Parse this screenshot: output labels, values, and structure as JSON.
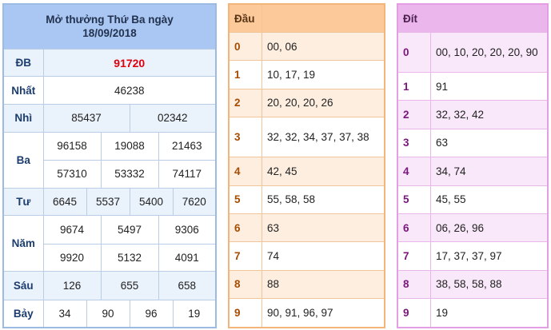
{
  "results": {
    "title_line1": "Mở thưởng Thứ Ba ngày",
    "title_line2": "18/09/2018",
    "rows": [
      {
        "label": "ĐB",
        "values": [
          "91720"
        ]
      },
      {
        "label": "Nhất",
        "values": [
          "46238"
        ]
      },
      {
        "label": "Nhì",
        "values": [
          "85437",
          "02342"
        ]
      },
      {
        "label": "Ba",
        "values": [
          "96158",
          "19088",
          "21463",
          "57310",
          "53332",
          "74117"
        ]
      },
      {
        "label": "Tư",
        "values": [
          "6645",
          "5537",
          "5400",
          "7620"
        ]
      },
      {
        "label": "Năm",
        "values": [
          "9674",
          "5497",
          "9306",
          "9920",
          "5132",
          "4091"
        ]
      },
      {
        "label": "Sáu",
        "values": [
          "126",
          "655",
          "658"
        ]
      },
      {
        "label": "Bảy",
        "values": [
          "34",
          "90",
          "96",
          "19"
        ]
      }
    ]
  },
  "dau": {
    "header": "Đầu",
    "rows": [
      {
        "key": "0",
        "values": "00, 06"
      },
      {
        "key": "1",
        "values": "10, 17, 19"
      },
      {
        "key": "2",
        "values": "20, 20, 20, 26"
      },
      {
        "key": "3",
        "values": "32, 32, 34, 37, 37, 38"
      },
      {
        "key": "4",
        "values": "42, 45"
      },
      {
        "key": "5",
        "values": "55, 58, 58"
      },
      {
        "key": "6",
        "values": "63"
      },
      {
        "key": "7",
        "values": "74"
      },
      {
        "key": "8",
        "values": "88"
      },
      {
        "key": "9",
        "values": "90, 91, 96, 97"
      }
    ]
  },
  "dit": {
    "header": "Đít",
    "rows": [
      {
        "key": "0",
        "values": "00, 10, 20, 20, 20, 90"
      },
      {
        "key": "1",
        "values": "91"
      },
      {
        "key": "2",
        "values": "32, 32, 42"
      },
      {
        "key": "3",
        "values": "63"
      },
      {
        "key": "4",
        "values": "34, 74"
      },
      {
        "key": "5",
        "values": "45, 55"
      },
      {
        "key": "6",
        "values": "06, 26, 96"
      },
      {
        "key": "7",
        "values": "17, 37, 37, 97"
      },
      {
        "key": "8",
        "values": "38, 58, 58, 88"
      },
      {
        "key": "9",
        "values": "19"
      }
    ]
  },
  "colors": {
    "results_header": "#a9c7f2",
    "special_prize": "#e0000d",
    "dau_header": "#fcc99a",
    "dit_header": "#ebb6ec"
  }
}
